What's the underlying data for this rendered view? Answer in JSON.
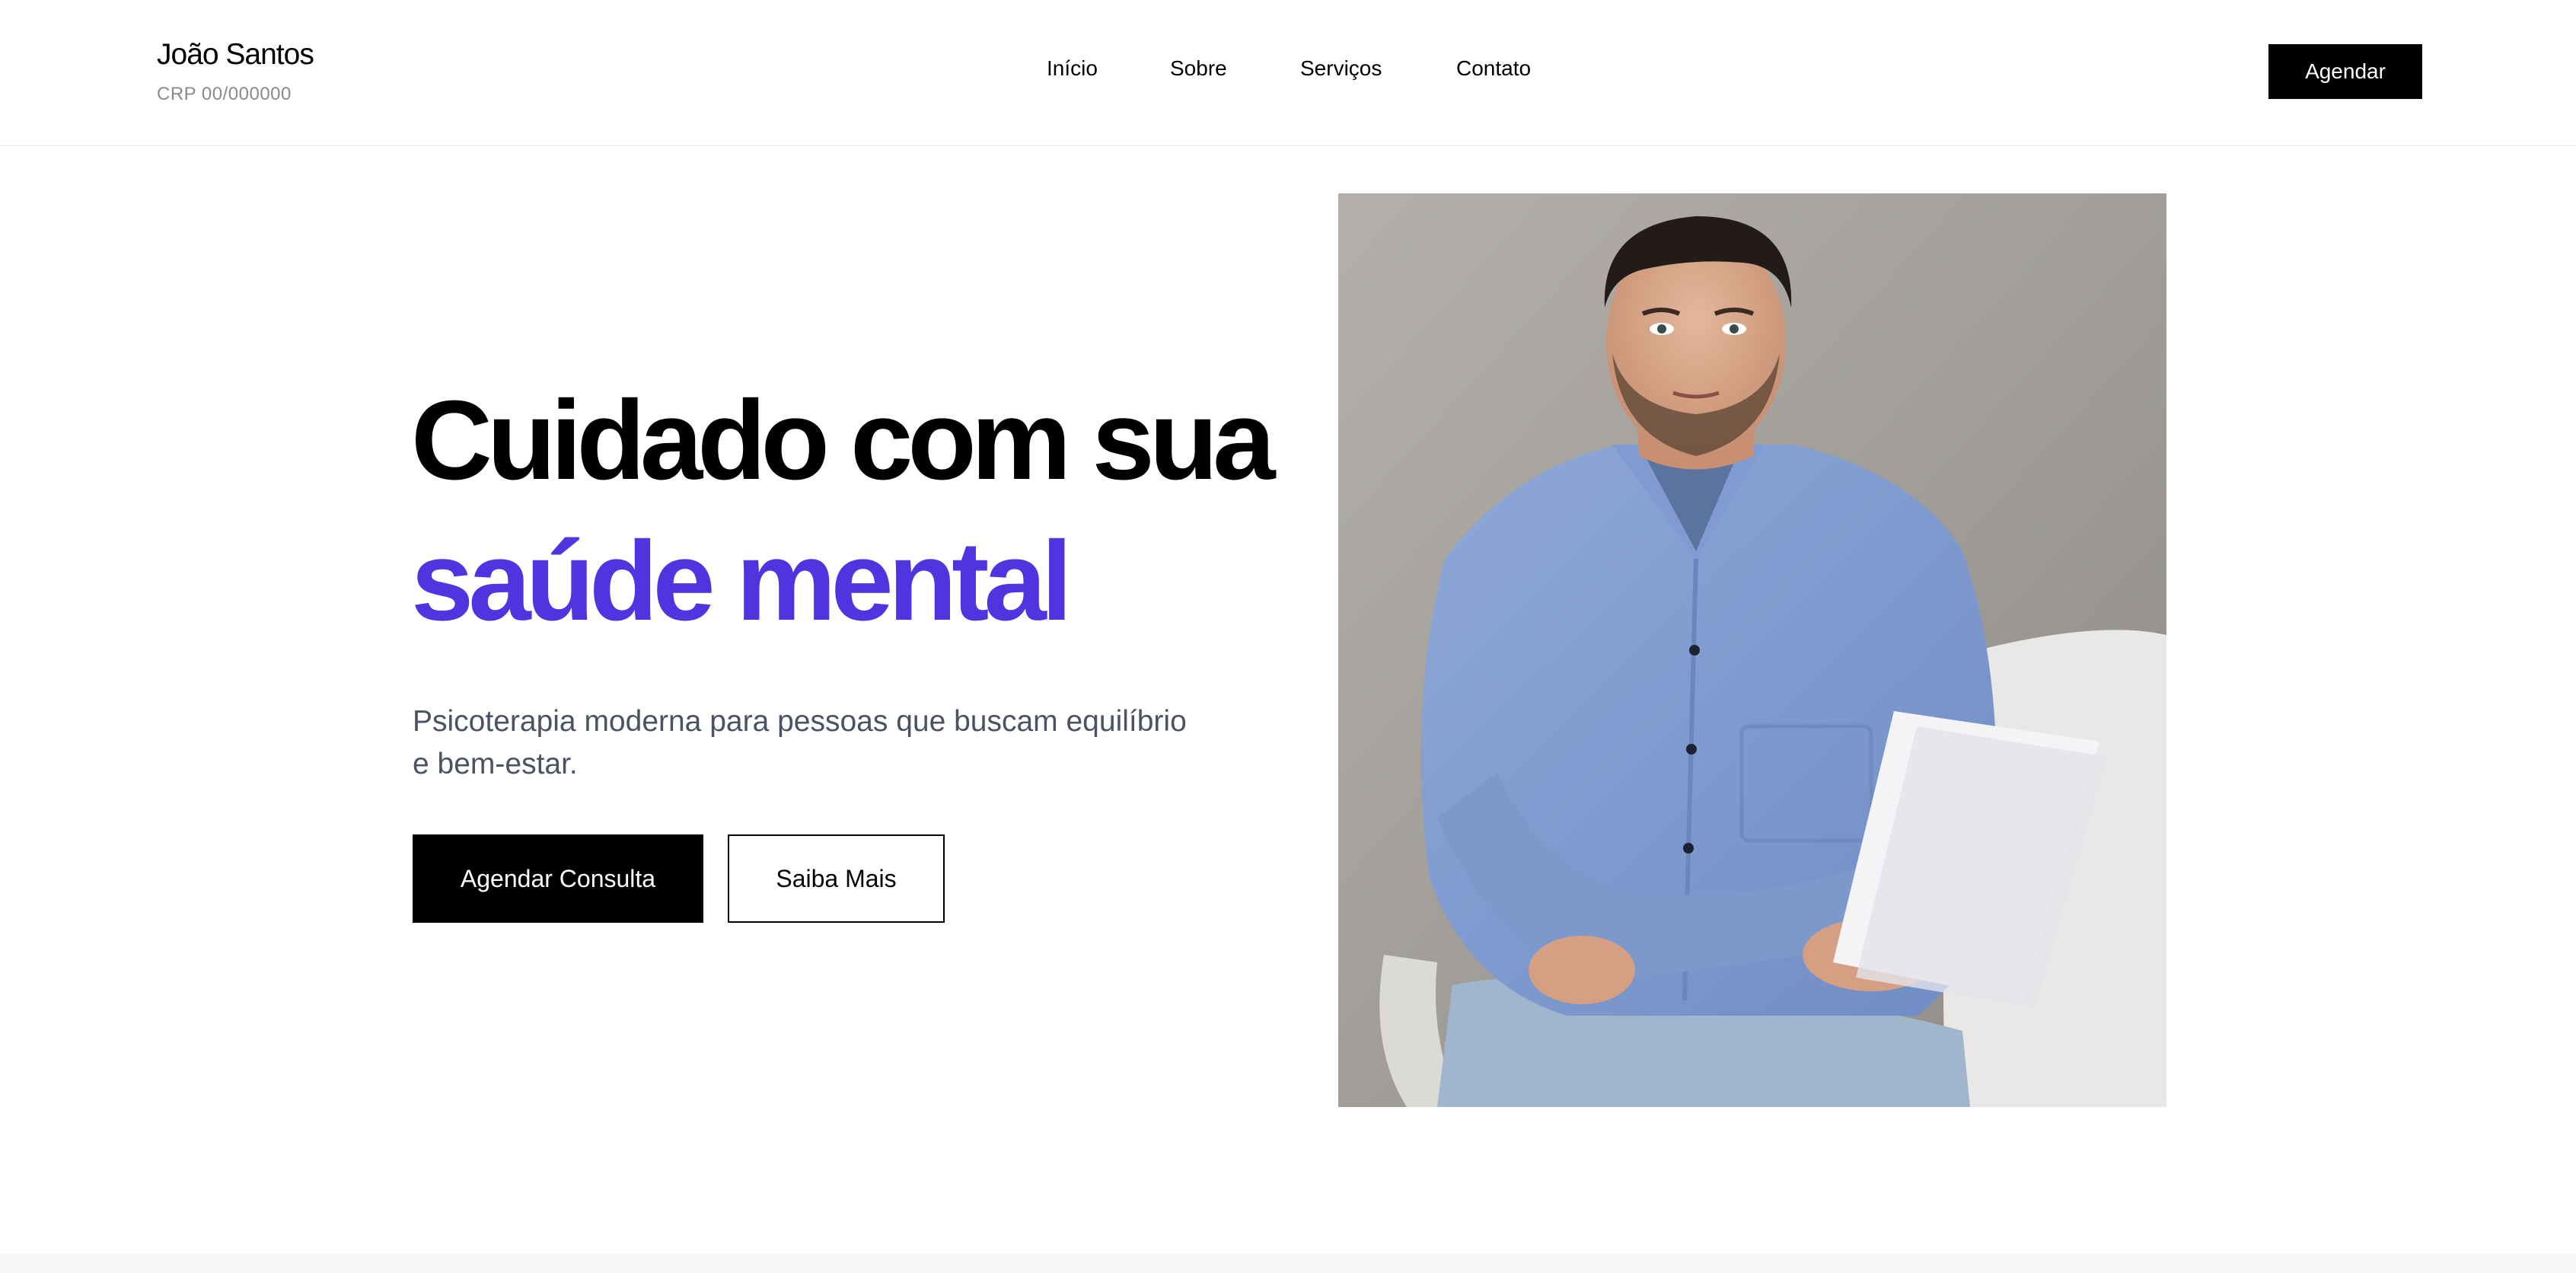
{
  "header": {
    "brand_name": "João Santos",
    "brand_crp": "CRP 00/000000",
    "nav": [
      "Início",
      "Sobre",
      "Serviços",
      "Contato"
    ],
    "cta": "Agendar"
  },
  "hero": {
    "title_line1": "Cuidado com sua",
    "title_line2": "saúde mental",
    "subtitle": "Psicoterapia moderna para pessoas que buscam equilíbrio e bem-estar.",
    "primary_button": "Agendar Consulta",
    "secondary_button": "Saiba Mais",
    "accent_color": "#4f35e0",
    "photo_alt": ""
  }
}
